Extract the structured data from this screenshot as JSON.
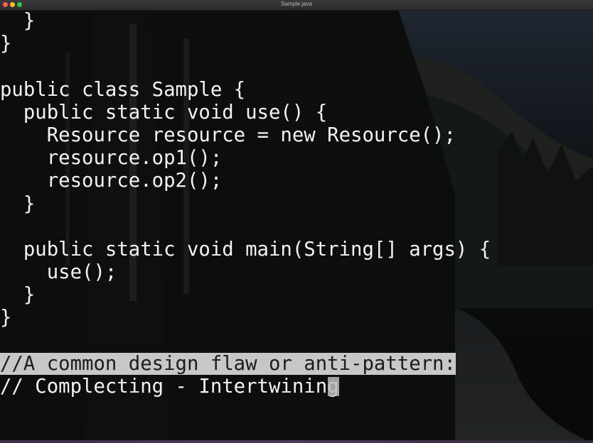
{
  "window": {
    "title": "Sample.java"
  },
  "editor": {
    "lines": [
      "  }",
      "}",
      "",
      "public class Sample {",
      "  public static void use() {",
      "    Resource resource = new Resource();",
      "    resource.op1();",
      "    resource.op2();",
      "  }",
      "",
      "  public static void main(String[] args) {",
      "    use();",
      "  }",
      "}",
      "",
      "//A common design flaw or anti-pattern:",
      "// Complecting - Intertwining"
    ]
  },
  "colors": {
    "text": "#f2f2f2",
    "selection": "#e1e1e1",
    "background": "#0e100f"
  }
}
